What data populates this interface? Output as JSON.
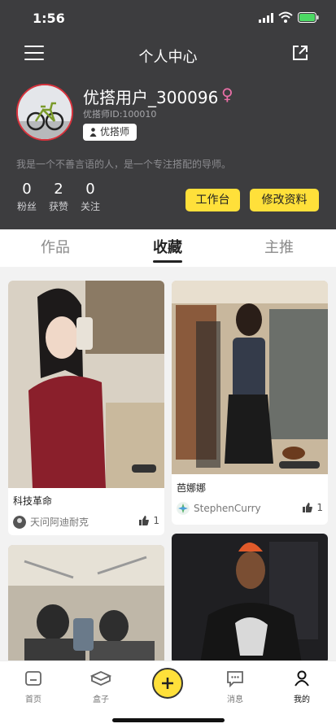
{
  "status_bar": {
    "time": "1:56"
  },
  "navbar": {
    "title": "个人中心"
  },
  "profile": {
    "username": "优搭用户_300096",
    "gender_symbol": "♀",
    "id_text": "优搭师ID:100010",
    "badge": "优搭师",
    "bio": "我是一个不善言语的人，是一个专注搭配的导师。"
  },
  "stats": [
    {
      "value": "0",
      "label": "粉丝"
    },
    {
      "value": "2",
      "label": "获赞"
    },
    {
      "value": "0",
      "label": "关注"
    }
  ],
  "actions": {
    "workbench": "工作台",
    "edit_profile": "修改资料"
  },
  "tabs": [
    {
      "label": "作品",
      "active": false
    },
    {
      "label": "收藏",
      "active": true
    },
    {
      "label": "主推",
      "active": false
    }
  ],
  "cards": [
    {
      "title": "科技革命",
      "author": "天问阿迪耐克",
      "likes": "1"
    },
    {
      "title": "芭娜娜",
      "author": "StephenCurry",
      "likes": "1"
    },
    {
      "title": "",
      "author": "",
      "likes": ""
    },
    {
      "title": "",
      "author": "",
      "likes": ""
    }
  ],
  "bottom_nav": [
    {
      "label": "首页",
      "icon": "home-icon"
    },
    {
      "label": "盒子",
      "icon": "box-icon"
    },
    {
      "label": "",
      "icon": "plus-icon"
    },
    {
      "label": "消息",
      "icon": "message-icon"
    },
    {
      "label": "我的",
      "icon": "profile-icon"
    }
  ],
  "colors": {
    "header_bg": "#3d3d3f",
    "accent_yellow": "#ffe03a",
    "gender_pink": "#e96fa6"
  }
}
